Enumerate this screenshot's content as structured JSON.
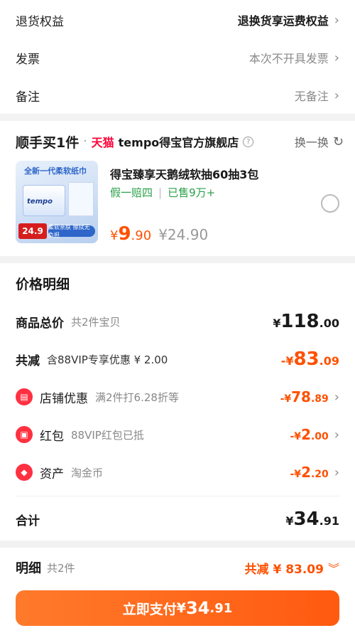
{
  "options": [
    {
      "label": "退货权益",
      "value": "退换货享运费权益",
      "strong": true
    },
    {
      "label": "发票",
      "value": "本次不开具发票",
      "strong": false
    },
    {
      "label": "备注",
      "value": "无备注",
      "strong": false
    }
  ],
  "addon": {
    "title": "顺手买1件",
    "dot": "·",
    "tmall": "天猫",
    "shop": "tempo得宝官方旗舰店",
    "swap_label": "换一换",
    "product": {
      "image_caption": "全新一代柔软纸巾",
      "image_logo": "tempo",
      "image_price": "24.9",
      "image_band": "柔软亲肤 擦拭无负担",
      "name": "得宝臻享天鹅绒软抽60抽3包",
      "tag1": "假一赔四",
      "tag_sep": "|",
      "tag2": "已售9万+",
      "price_symbol": "¥",
      "price_int": "9",
      "price_dec": ".90",
      "old_price": "¥24.90"
    }
  },
  "price": {
    "title": "价格明细",
    "total": {
      "label": "商品总价",
      "sub": "共2件宝贝",
      "sym": "¥",
      "int": "118",
      "dec": ".00"
    },
    "reduce": {
      "label": "共减",
      "sub": "含88VIP专享优惠 ¥ 2.00",
      "sym": "-¥",
      "int": "83",
      "dec": ".09"
    },
    "shop_discount": {
      "label": "店铺优惠",
      "sub": "满2件打6.28折等",
      "sym": "-¥",
      "int": "78",
      "dec": ".89"
    },
    "redpacket": {
      "label": "红包",
      "sub": "88VIP红包已抵",
      "sym": "-¥",
      "int": "2",
      "dec": ".00"
    },
    "assets": {
      "label": "资产",
      "sub": "淘金币",
      "sym": "-¥",
      "int": "2",
      "dec": ".20"
    },
    "sum": {
      "label": "合计",
      "sym": "¥",
      "int": "34",
      "dec": ".91"
    }
  },
  "bottom": {
    "label": "明细",
    "sub": "共2件",
    "reduce_text": "共减 ¥ 83.09",
    "pay_label": "立即支付",
    "pay_sym": "¥",
    "pay_int": "34",
    "pay_dec": ".91"
  },
  "colors": {
    "accent": "#ff5000",
    "tmall": "#ff0036",
    "green": "#2aa04a",
    "icon_red": "#ff3040"
  }
}
